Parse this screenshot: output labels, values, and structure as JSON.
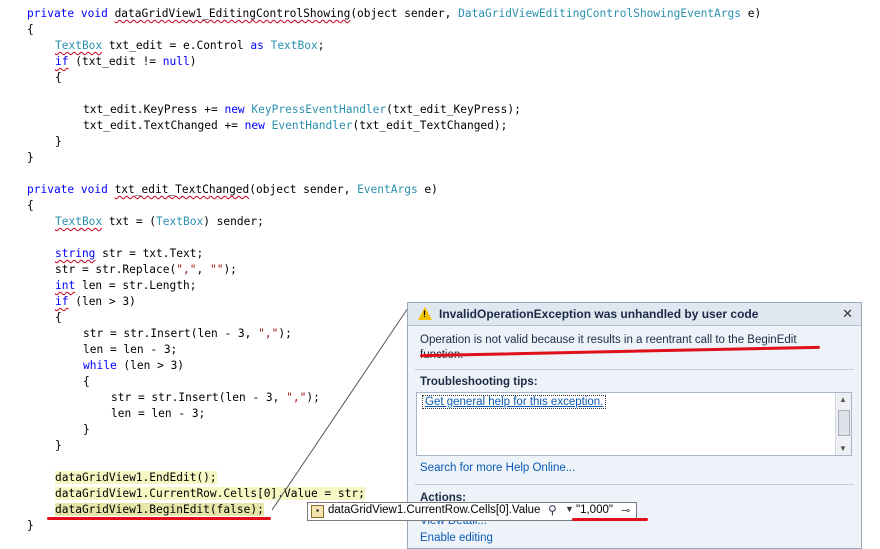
{
  "code": {
    "line1": {
      "a": "private void ",
      "b": "dataGridView1_EditingControlShowing",
      "c": "(object sender, ",
      "d": "DataGridViewEditingControlShowingEventArgs",
      "e": " e)"
    },
    "line2": "{",
    "line3": {
      "a": "TextBox",
      "b": " txt_edit = e.Control ",
      "c": "as",
      "d": " ",
      "e": "TextBox",
      "f": ";"
    },
    "line4": {
      "a": "if",
      "b": " (txt_edit != ",
      "c": "null",
      "d": ")"
    },
    "line5": "{",
    "line7": {
      "a": "txt_edit.KeyPress += ",
      "b": "new",
      "c": " ",
      "d": "KeyPressEventHandler",
      "e": "(txt_edit_KeyPress);"
    },
    "line8": {
      "a": "txt_edit.TextChanged += ",
      "b": "new",
      "c": " ",
      "d": "EventHandler",
      "e": "(txt_edit_TextChanged);"
    },
    "line9": "}",
    "line10": "}",
    "line12": {
      "a": "private void ",
      "b": "txt_edit_TextChanged",
      "c": "(object sender, ",
      "d": "EventArgs",
      "e": " e)"
    },
    "line13": "{",
    "line14": {
      "a": "TextBox",
      "b": " txt = (",
      "c": "TextBox",
      "d": ") sender;"
    },
    "line16": {
      "a": "string",
      "b": " str = txt.Text;"
    },
    "line17": {
      "a": "str = str.Replace(",
      "b": "\",\"",
      "c": ", ",
      "d": "\"\"",
      "e": ");"
    },
    "line18": {
      "a": "int",
      "b": " len = str.Length;"
    },
    "line19": {
      "a": "if",
      "b": " (len > 3)"
    },
    "line20": "{",
    "line21": {
      "a": "str = str.Insert(len - 3, ",
      "b": "\",\"",
      "c": ");"
    },
    "line22": "len = len - 3;",
    "line23": {
      "a": "while",
      "b": " (len > 3)"
    },
    "line24": "{",
    "line25": {
      "a": "str = str.Insert(len - 3, ",
      "b": "\",\"",
      "c": ");"
    },
    "line26": "len = len - 3;",
    "line27": "}",
    "line28": "}",
    "line30": "dataGridView1.EndEdit();",
    "line31": "dataGridView1.CurrentRow.Cells[0].Value = str;",
    "line32": "dataGridView1.BeginEdit(false);",
    "line33": "}"
  },
  "exception_dialog": {
    "title": "InvalidOperationException was unhandled by user code",
    "close_glyph": "✕",
    "message": "Operation is not valid because it results in a reentrant call to the BeginEdit function.",
    "troubleshooting_heading": "Troubleshooting tips:",
    "tip_link": "Get general help for this exception.",
    "search_link": "Search for more Help Online...",
    "actions_heading": "Actions:",
    "action_view_detail": "View Detail...",
    "action_enable_editing": "Enable editing"
  },
  "data_tip": {
    "expression": "dataGridView1.CurrentRow.Cells[0].Value",
    "value": "\"1,000\""
  },
  "colors": {
    "keyword": "#0000ff",
    "type": "#2b91af",
    "string": "#a31515",
    "annotation_red": "#e0101a"
  }
}
